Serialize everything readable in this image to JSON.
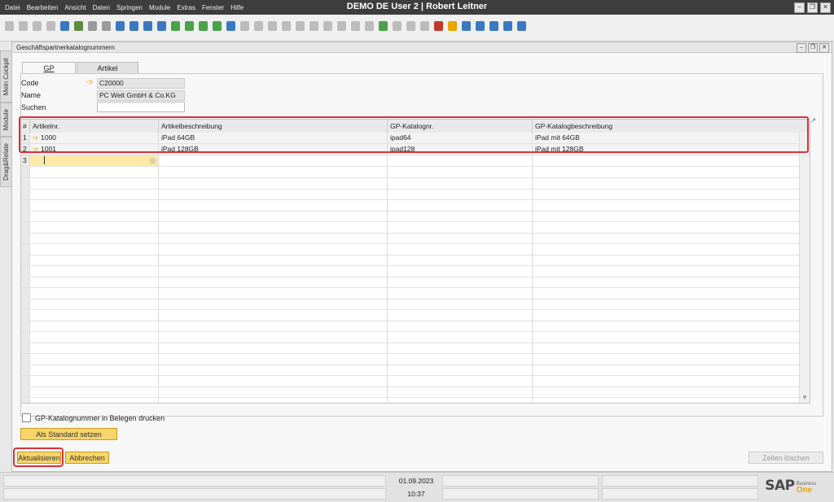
{
  "app": {
    "title": "DEMO DE User 2 | Robert Leitner",
    "menu": [
      "Datei",
      "Bearbeiten",
      "Ansicht",
      "Daten",
      "Springen",
      "Module",
      "Extras",
      "Fenster",
      "Hilfe"
    ]
  },
  "side_tabs": [
    "Mein Cockpit",
    "Module",
    "Drag&Relate"
  ],
  "form": {
    "title": "Geschäftspartnerkatalognummern",
    "tabs": [
      "GP",
      "Artikel"
    ],
    "fields": {
      "code_label": "Code",
      "code_value": "C20000",
      "name_label": "Name",
      "name_value": "PC Welt GmbH & Co.KG",
      "search_label": "Suchen",
      "search_value": ""
    },
    "grid": {
      "headers": [
        "#",
        "Artikelnr.",
        "Artikelbeschreibung",
        "GP-Katalognr.",
        "GP-Katalogbeschreibung"
      ],
      "rows": [
        {
          "num": "1",
          "item": "1000",
          "desc": "iPad 64GB",
          "catno": "ipad64",
          "catdesc": "iPad mit 64GB"
        },
        {
          "num": "2",
          "item": "1001",
          "desc": "iPad 128GB",
          "catno": "ipad128",
          "catdesc": "iPad mit 128GB"
        }
      ],
      "new_row_num": "3"
    },
    "checkbox_label": "GP-Katalognummer in Belegen drucken",
    "buttons": {
      "set_default": "Als Standard setzen",
      "update": "Aktualisieren",
      "cancel": "Abbrechen",
      "delete_rows": "Zeilen löschen"
    }
  },
  "status": {
    "date": "01.09.2023",
    "time": "10:37"
  },
  "brand": {
    "logo": "SAP",
    "sub1": "Business",
    "sub2": "One"
  }
}
